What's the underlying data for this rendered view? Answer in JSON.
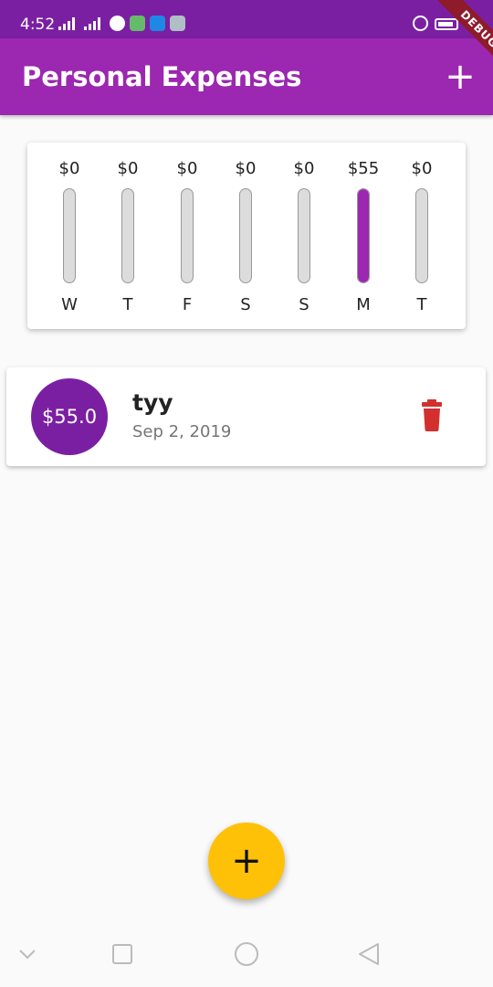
{
  "status_bar": {
    "time": "4:52",
    "debug_label": "DEBUG"
  },
  "app_bar": {
    "title": "Personal Expenses",
    "add_icon": "plus-icon",
    "add_label": "+"
  },
  "chart": {
    "accent_color": "#9c27b0",
    "days": [
      {
        "label": "W",
        "amount": "$0",
        "fraction": 0
      },
      {
        "label": "T",
        "amount": "$0",
        "fraction": 0
      },
      {
        "label": "F",
        "amount": "$0",
        "fraction": 0
      },
      {
        "label": "S",
        "amount": "$0",
        "fraction": 0
      },
      {
        "label": "S",
        "amount": "$0",
        "fraction": 0
      },
      {
        "label": "M",
        "amount": "$55",
        "fraction": 1
      },
      {
        "label": "T",
        "amount": "$0",
        "fraction": 0
      }
    ]
  },
  "transactions": [
    {
      "amount": "$55.0",
      "title": "tyy",
      "date": "Sep 2, 2019",
      "delete_icon": "trash-icon"
    }
  ],
  "fab": {
    "icon": "plus-icon",
    "label": "+"
  },
  "colors": {
    "primary": "#9c27b0",
    "primary_dark": "#7b1fa2",
    "accent": "#ffc107",
    "delete": "#d32f2f"
  }
}
